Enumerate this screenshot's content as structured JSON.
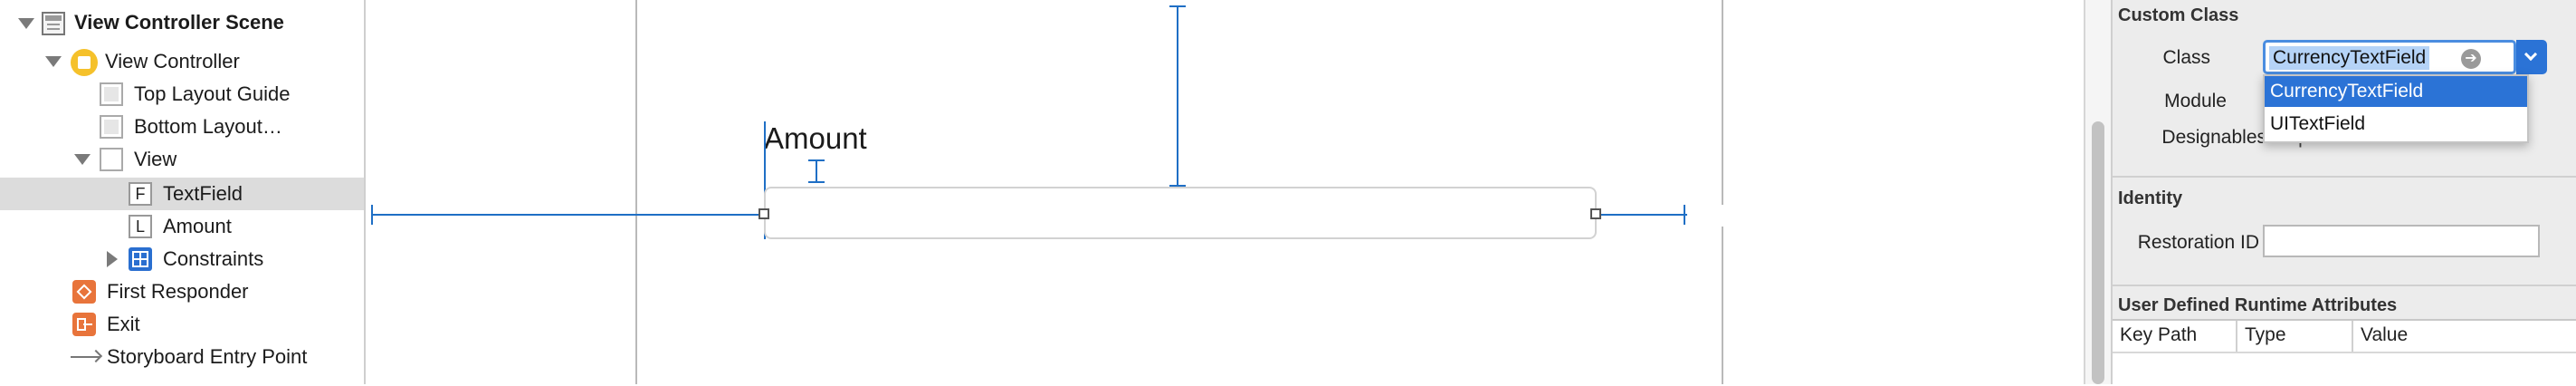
{
  "outline": {
    "items": [
      {
        "label": "View Controller Scene",
        "icon": "scene-icon"
      },
      {
        "label": "View Controller",
        "icon": "view-controller-icon"
      },
      {
        "label": "Top Layout Guide",
        "icon": "layout-guide-icon"
      },
      {
        "label": "Bottom Layout…",
        "icon": "layout-guide-icon"
      },
      {
        "label": "View",
        "icon": "view-icon"
      },
      {
        "label": "TextField",
        "icon": "textfield-icon",
        "badge": "F"
      },
      {
        "label": "Amount",
        "icon": "label-icon",
        "badge": "L"
      },
      {
        "label": "Constraints",
        "icon": "constraints-icon"
      },
      {
        "label": "First Responder",
        "icon": "first-responder-icon"
      },
      {
        "label": "Exit",
        "icon": "exit-icon"
      },
      {
        "label": "Storyboard Entry Point",
        "icon": "entry-arrow-icon"
      }
    ]
  },
  "canvas": {
    "label_text": "Amount"
  },
  "inspector": {
    "custom_class": {
      "title": "Custom Class",
      "class_label": "Class",
      "class_value": "CurrencyTextField",
      "module_label": "Module",
      "designables_label": "Designables",
      "designables_value": "Up to date",
      "dropdown_options": [
        "CurrencyTextField",
        "UITextField"
      ],
      "selected_option": "CurrencyTextField"
    },
    "identity": {
      "title": "Identity",
      "restoration_label": "Restoration ID",
      "restoration_value": ""
    },
    "runtime_attributes": {
      "title": "User Defined Runtime Attributes",
      "columns": [
        "Key Path",
        "Type",
        "Value"
      ]
    }
  },
  "colors": {
    "selection_blue": "#2b73d6",
    "constraint_blue": "#1f6fc5",
    "row_highlight": "#dcdcdc"
  }
}
